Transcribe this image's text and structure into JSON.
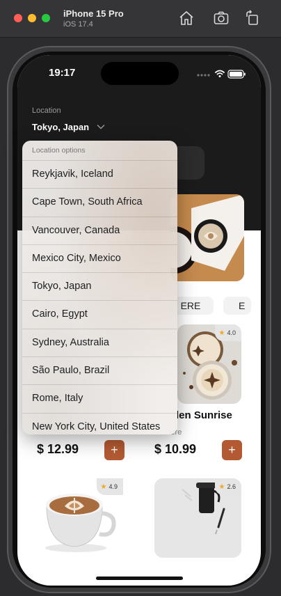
{
  "simulator": {
    "device_name": "iPhone 15 Pro",
    "os_version": "iOS 17.4",
    "toolbar_icons": [
      "home-icon",
      "screenshot-icon",
      "rotate-icon"
    ]
  },
  "status_bar": {
    "time": "19:17"
  },
  "location": {
    "label": "Location",
    "current": "Tokyo, Japan"
  },
  "dropdown": {
    "header": "Location options",
    "options": [
      "Reykjavik, Iceland",
      "Cape Town, South Africa",
      "Vancouver, Canada",
      "Mexico City, Mexico",
      "Tokyo, Japan",
      "Cairo, Egypt",
      "Sydney, Australia",
      "São Paulo, Brazil",
      "Rome, Italy",
      "New York City, United States"
    ]
  },
  "categories": {
    "chip_1": "ERE",
    "chip_2": "E"
  },
  "products": [
    {
      "rating": "",
      "title": "",
      "subtitle": "",
      "price": "$ 12.99"
    },
    {
      "rating": "4.0",
      "title": "len Sunrise",
      "subtitle": "iere",
      "price": "$ 10.99"
    },
    {
      "rating": "4.9"
    },
    {
      "rating": "2.6"
    }
  ],
  "add_button_label": "+",
  "colors": {
    "accent": "#b35a32",
    "header_bg": "#1b1b1b",
    "star": "#f5a623"
  }
}
